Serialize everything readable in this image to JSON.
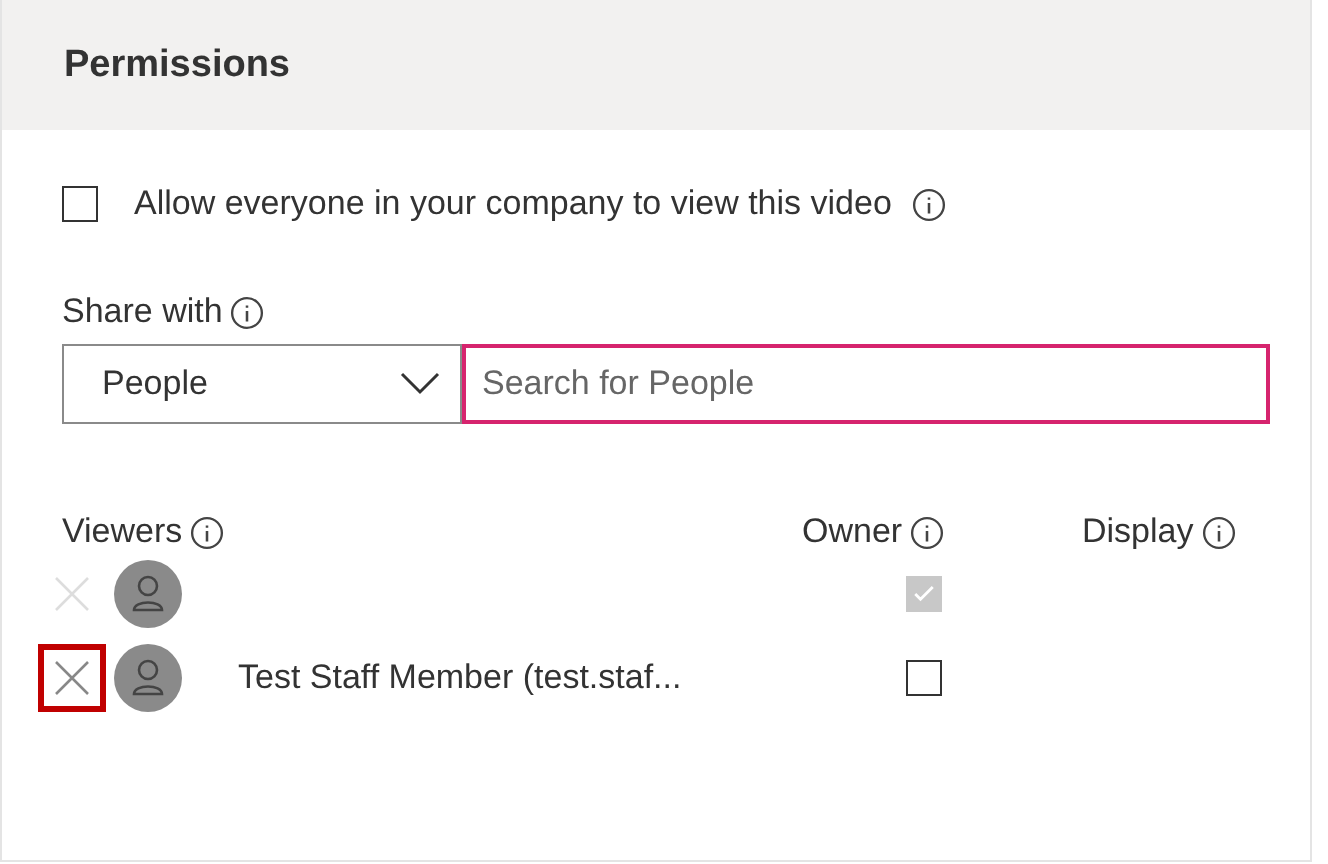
{
  "panel": {
    "title": "Permissions"
  },
  "allow_everyone": {
    "label": "Allow everyone in your company to view this video",
    "checked": false
  },
  "share_with": {
    "label": "Share with",
    "dropdown": {
      "value": "People"
    },
    "search": {
      "placeholder": "Search for People",
      "focused": true
    }
  },
  "viewers": {
    "columns": [
      "Viewers",
      "Owner",
      "Display"
    ],
    "rows": [
      {
        "name": "",
        "remove_disabled": true,
        "highlighted": false,
        "owner": {
          "checked": true,
          "disabled": true
        }
      },
      {
        "name": "Test Staff Member (test.staf...",
        "remove_disabled": false,
        "highlighted": true,
        "owner": {
          "checked": false,
          "disabled": false
        }
      }
    ]
  }
}
